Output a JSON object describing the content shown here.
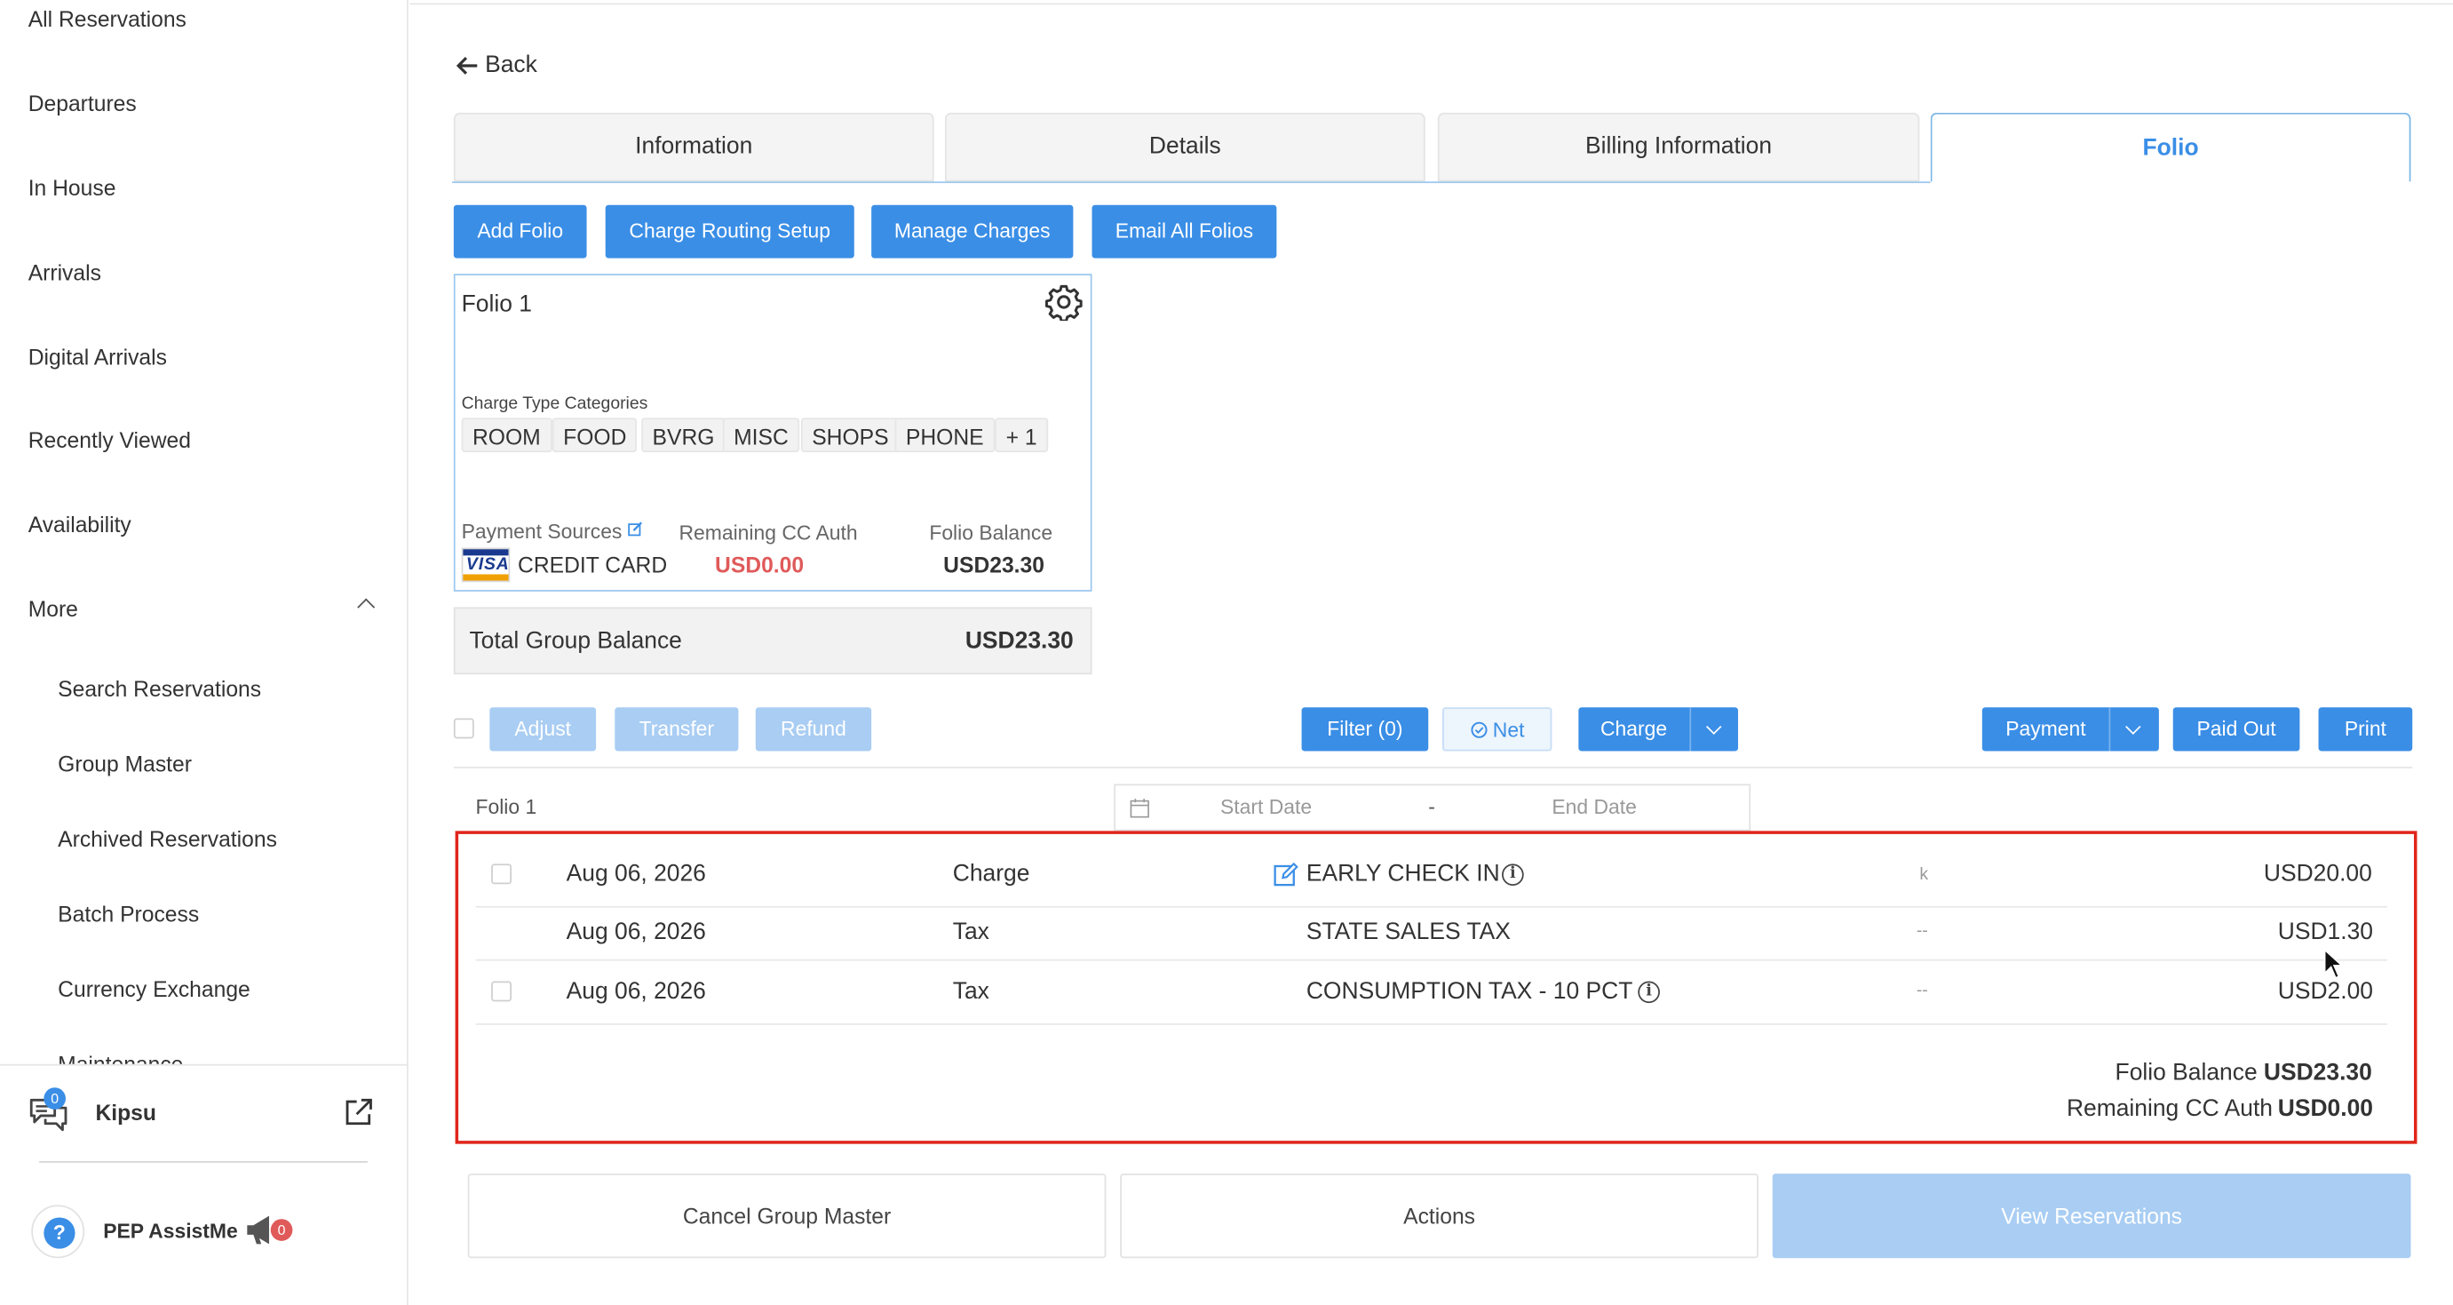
{
  "sidebar": {
    "items": [
      "All Reservations",
      "Departures",
      "In House",
      "Arrivals",
      "Digital Arrivals",
      "Recently Viewed",
      "Availability",
      "More"
    ],
    "sub_items": [
      "Search Reservations",
      "Group Master",
      "Archived Reservations",
      "Batch Process",
      "Currency Exchange",
      "Maintenance"
    ],
    "kipsu": {
      "label": "Kipsu",
      "badge": "0"
    },
    "pep": {
      "label": "PEP AssistMe",
      "badge": "0",
      "help_glyph": "?"
    }
  },
  "back_label": "Back",
  "tabs": [
    {
      "label": "Information",
      "active": false
    },
    {
      "label": "Details",
      "active": false
    },
    {
      "label": "Billing Information",
      "active": false
    },
    {
      "label": "Folio",
      "active": true
    }
  ],
  "actions": {
    "add_folio": "Add Folio",
    "charge_routing": "Charge Routing Setup",
    "manage_charges": "Manage Charges",
    "email_all": "Email All Folios"
  },
  "folio_card": {
    "title": "Folio 1",
    "charge_type_label": "Charge Type Categories",
    "chips": [
      "ROOM",
      "FOOD",
      "BVRG",
      "MISC",
      "SHOPS",
      "PHONE",
      "+ 1"
    ],
    "payment_sources_label": "Payment Sources",
    "remaining_cc_label": "Remaining CC Auth",
    "folio_balance_label": "Folio Balance",
    "card_brand": "VISA",
    "payment_source": "CREDIT CARD",
    "remaining_cc_value": "USD0.00",
    "folio_balance_value": "USD23.30"
  },
  "total_group": {
    "label": "Total Group Balance",
    "value": "USD23.30"
  },
  "toolbar": {
    "adjust": "Adjust",
    "transfer": "Transfer",
    "refund": "Refund",
    "filter": "Filter (0)",
    "net": "Net",
    "charge": "Charge",
    "payment": "Payment",
    "paid_out": "Paid Out",
    "print": "Print"
  },
  "table": {
    "folio_label": "Folio 1",
    "start_date_placeholder": "Start Date",
    "end_date_placeholder": "End Date",
    "range_sep": "-",
    "rows": [
      {
        "date": "Aug 06, 2026",
        "type": "Charge",
        "desc": "EARLY CHECK IN",
        "ref": "k",
        "amount": "USD20.00"
      },
      {
        "date": "Aug 06, 2026",
        "type": "Tax",
        "desc": "STATE SALES TAX",
        "ref": "--",
        "amount": "USD1.30"
      },
      {
        "date": "Aug 06, 2026",
        "type": "Tax",
        "desc": "CONSUMPTION TAX - 10 PCT",
        "ref": "--",
        "amount": "USD2.00"
      }
    ],
    "summary": {
      "folio_balance_label": "Folio Balance",
      "folio_balance_value": "USD23.30",
      "remaining_cc_label": "Remaining CC Auth",
      "remaining_cc_value": "USD0.00"
    }
  },
  "bottom": {
    "cancel": "Cancel Group Master",
    "actions": "Actions",
    "view_reservations": "View Reservations"
  },
  "colors": {
    "accent": "#3a8ee6",
    "danger": "#e05a5a",
    "highlight_border": "#e0251b"
  }
}
